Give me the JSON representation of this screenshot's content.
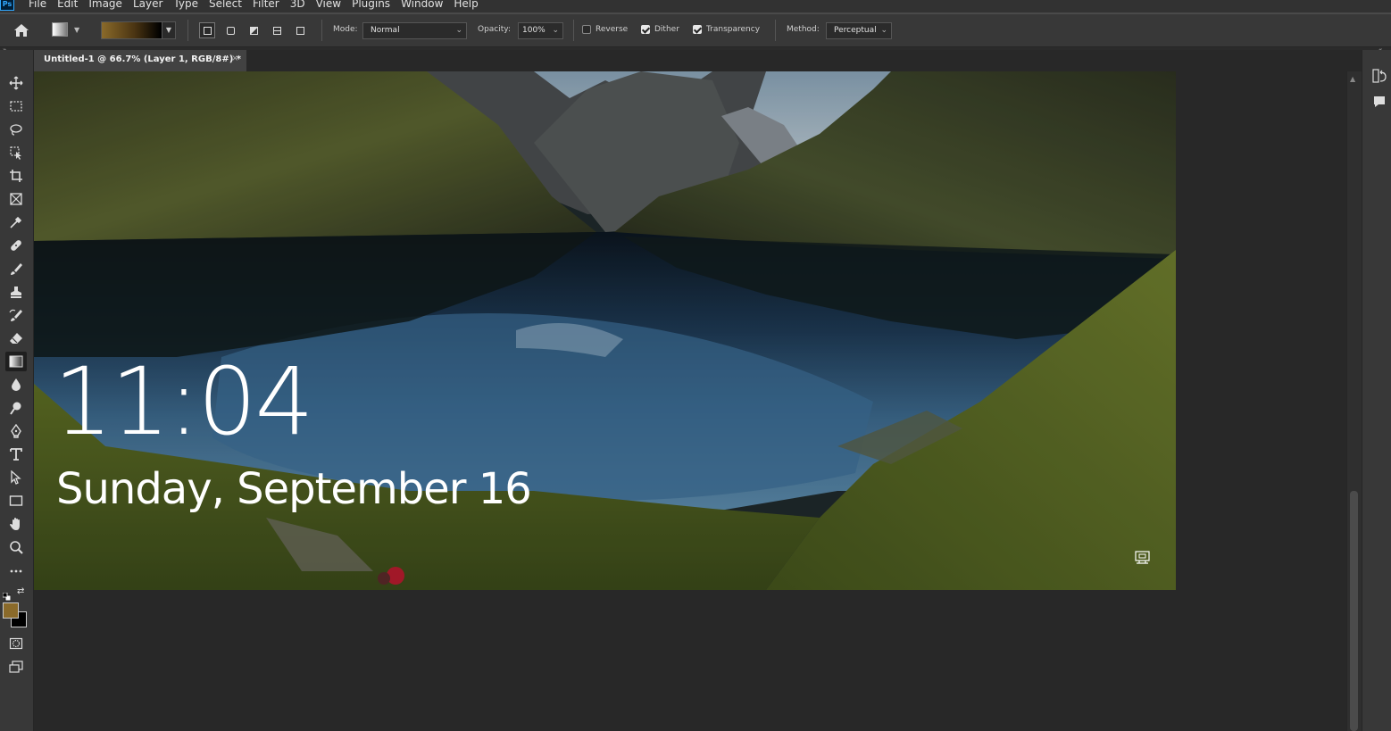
{
  "app": {
    "logo_text": "Ps",
    "menu": [
      "File",
      "Edit",
      "Image",
      "Layer",
      "Type",
      "Select",
      "Filter",
      "3D",
      "View",
      "Plugins",
      "Window",
      "Help"
    ]
  },
  "options": {
    "mode_label": "Mode:",
    "mode_value": "Normal",
    "opacity_label": "Opacity:",
    "opacity_value": "100%",
    "reverse_label": "Reverse",
    "reverse_checked": false,
    "dither_label": "Dither",
    "dither_checked": true,
    "transparency_label": "Transparency",
    "transparency_checked": true,
    "method_label": "Method:",
    "method_value": "Perceptual",
    "gradient_colors": [
      "#8a6a2a",
      "#000000"
    ]
  },
  "document": {
    "tab_title": "Untitled-1 @ 66.7% (Layer 1, RGB/8#) *",
    "close_glyph": "×"
  },
  "lockscreen": {
    "time": "11:04",
    "date": "Sunday, September 16"
  },
  "colors": {
    "foreground": "#8a6a2a",
    "background": "#000000",
    "accent": "#31a8ff"
  }
}
